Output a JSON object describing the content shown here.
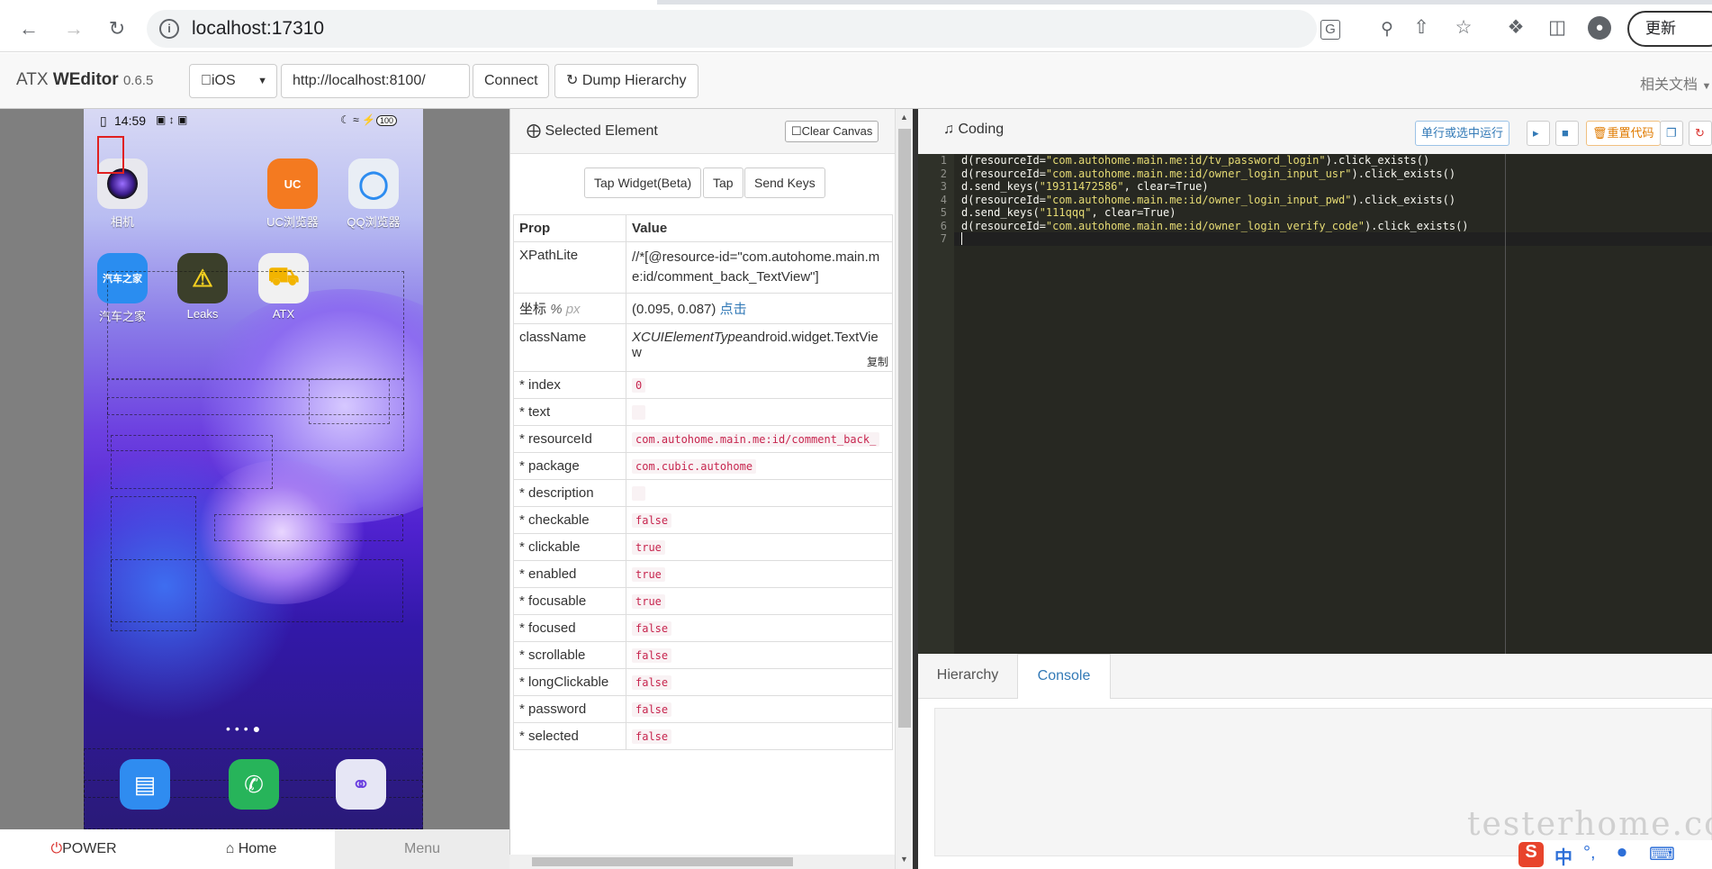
{
  "browser": {
    "url": "localhost:17310",
    "update_label": "更新"
  },
  "app": {
    "brand_prefix": "ATX",
    "brand_name": "WEditor",
    "version": "0.6.5",
    "platform_select": "iOS",
    "device_url": "http://localhost:8100/",
    "connect_label": "Connect",
    "dump_label": "Dump Hierarchy",
    "docs_link": "相关文档"
  },
  "phone": {
    "time": "14:59",
    "battery": "100",
    "apps": [
      {
        "label": "相机",
        "icon": "camera-icon",
        "color": "#e8e8ee"
      },
      {
        "label": "UC浏览器",
        "icon": "uc-browser-icon",
        "color": "#f47a20"
      },
      {
        "label": "QQ浏览器",
        "icon": "qq-browser-icon",
        "color": "#e9eef5"
      },
      {
        "label": "汽车之家",
        "icon": "autohome-icon",
        "color": "#2a8df0",
        "text": "汽车之家"
      },
      {
        "label": "Leaks",
        "icon": "leaks-icon",
        "color": "#3b3f2a"
      },
      {
        "label": "ATX",
        "icon": "atx-taxi-icon",
        "color": "#f1f1f1"
      }
    ],
    "dock": [
      {
        "icon": "messages-icon",
        "color": "#2f8cf0"
      },
      {
        "icon": "phone-icon",
        "color": "#27b45a"
      },
      {
        "icon": "browser-planet-icon",
        "color": "#e6e6f5"
      }
    ],
    "buttons": {
      "power": "POWER",
      "home": "Home",
      "menu": "Menu"
    }
  },
  "selected": {
    "title": "Selected Element",
    "clear_canvas": "Clear Canvas",
    "tap_widget": "Tap Widget(Beta)",
    "tap": "Tap",
    "send_keys": "Send Keys",
    "col_prop": "Prop",
    "col_value": "Value",
    "xpath_label": "XPathLite",
    "xpath_value": "//*[@resource-id=\"com.autohome.main.me:id/comment_back_TextView\"]",
    "coord_label": "坐标",
    "coord_unit_pct": "%",
    "coord_unit_px": "px",
    "coord_value": "(0.095, 0.087)",
    "coord_click": "点击",
    "classname_label": "className",
    "classname_prefix": "XCUIElementType",
    "classname_value": "android.widget.TextView",
    "copy_label": "复制",
    "rows": [
      {
        "key": "* index",
        "value": "0"
      },
      {
        "key": "* text",
        "value": ""
      },
      {
        "key": "* resourceId",
        "value": "com.autohome.main.me:id/comment_back_"
      },
      {
        "key": "* package",
        "value": "com.cubic.autohome"
      },
      {
        "key": "* description",
        "value": ""
      },
      {
        "key": "* checkable",
        "value": "false"
      },
      {
        "key": "* clickable",
        "value": "true"
      },
      {
        "key": "* enabled",
        "value": "true"
      },
      {
        "key": "* focusable",
        "value": "true"
      },
      {
        "key": "* focused",
        "value": "false"
      },
      {
        "key": "* scrollable",
        "value": "false"
      },
      {
        "key": "* longClickable",
        "value": "false"
      },
      {
        "key": "* password",
        "value": "false"
      },
      {
        "key": "* selected",
        "value": "false"
      }
    ]
  },
  "coding": {
    "title": "Coding",
    "run_label": "单行或选中运行",
    "reset_label": "重置代码",
    "line_numbers": [
      "1",
      "2",
      "3",
      "4",
      "5",
      "6",
      "7"
    ],
    "lines": [
      [
        "d(resourceId=",
        "\"com.autohome.main.me:id/tv_password_login\"",
        ").click_exists()"
      ],
      [
        "d(resourceId=",
        "\"com.autohome.main.me:id/owner_login_input_usr\"",
        ").click_exists()"
      ],
      [
        "d.send_keys(",
        "\"19311472586\"",
        ", clear=True)"
      ],
      [
        "d(resourceId=",
        "\"com.autohome.main.me:id/owner_login_input_pwd\"",
        ").click_exists()"
      ],
      [
        "d.send_keys(",
        "\"111qqq\"",
        ", clear=True)"
      ],
      [
        "d(resourceId=",
        "\"com.autohome.main.me:id/owner_login_verify_code\"",
        ").click_exists()"
      ],
      [
        "",
        "",
        ""
      ]
    ],
    "tab_hierarchy": "Hierarchy",
    "tab_console": "Console"
  },
  "watermark": "testerhome.com",
  "ime": {
    "lang": "中"
  },
  "colors": {
    "accent": "#337ab7",
    "editor_bg": "#272822",
    "string": "#e6db74",
    "power": "#d9302c"
  }
}
